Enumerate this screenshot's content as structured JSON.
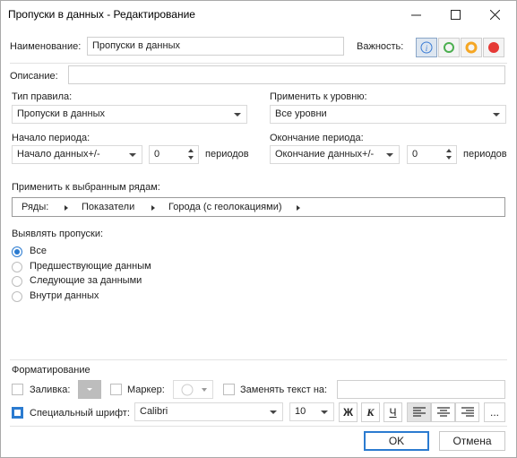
{
  "window": {
    "title": "Пропуски в данных - Редактирование",
    "minimize": "—",
    "maximize": "☐",
    "close": "✕"
  },
  "name": {
    "label": "Наименование:",
    "value": "Пропуски в данных"
  },
  "importance": {
    "label": "Важность:",
    "levels": [
      {
        "name": "info",
        "color": "#3a7bd5"
      },
      {
        "name": "low",
        "color": "#4caf50"
      },
      {
        "name": "medium",
        "color": "#f5a623"
      },
      {
        "name": "high",
        "color": "#e53935"
      }
    ]
  },
  "description": {
    "label": "Описание:",
    "value": ""
  },
  "rule_type": {
    "label": "Тип правила:",
    "value": "Пропуски в данных"
  },
  "apply_level": {
    "label": "Применить к уровню:",
    "value": "Все уровни"
  },
  "period_start": {
    "label": "Начало периода:",
    "value": "Начало данных+/-",
    "count": "0",
    "unit": "периодов"
  },
  "period_end": {
    "label": "Окончание периода:",
    "value": "Окончание данных+/-",
    "count": "0",
    "unit": "периодов"
  },
  "apply_rows": {
    "label": "Применить к выбранным рядам:",
    "crumbs": [
      "Ряды:",
      "Показатели",
      "Города (с геолокациями)"
    ]
  },
  "detect": {
    "label": "Выявлять пропуски:",
    "options": [
      "Все",
      "Предшествующие данным",
      "Следующие за данными",
      "Внутри данных"
    ],
    "selected": "Все"
  },
  "formatting": {
    "label": "Форматирование",
    "fill": {
      "label": "Заливка:",
      "checked": false
    },
    "marker": {
      "label": "Маркер:",
      "checked": false
    },
    "replace": {
      "label": "Заменять текст на:",
      "checked": false,
      "value": ""
    },
    "font": {
      "label": "Специальный шрифт:",
      "checked": true,
      "family": "Calibri",
      "size": "10"
    },
    "bold": "Ж",
    "italic": "К",
    "underline": "Ч",
    "more": "..."
  },
  "buttons": {
    "ok": "OK",
    "cancel": "Отмена"
  },
  "colors": {
    "accent": "#2b7bd0"
  }
}
